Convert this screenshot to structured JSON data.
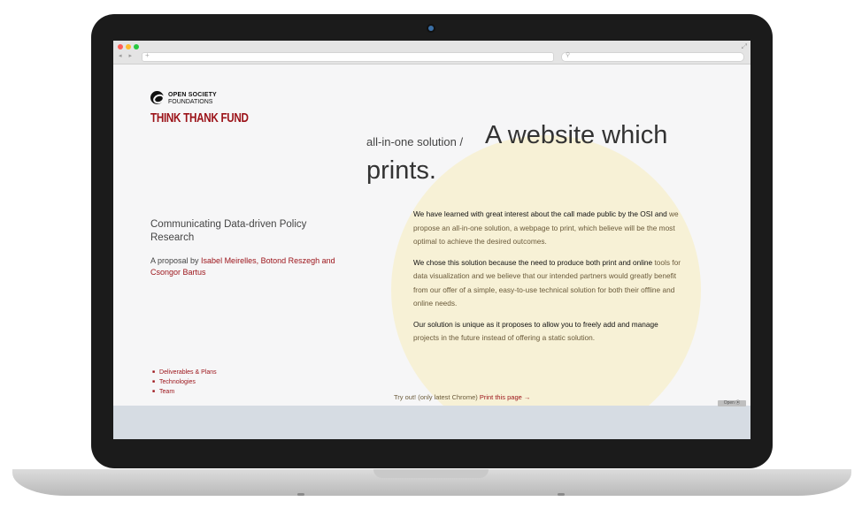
{
  "browser": {
    "traffic_colors": [
      "#ff5f57",
      "#febc2e",
      "#28c840"
    ],
    "nav": "◂ ▸",
    "url_plus": "+",
    "search_icon": "⚲",
    "resize_icon": "⤢"
  },
  "logo": {
    "org_line1": "OPEN SOCIETY",
    "org_line2": "FOUNDATIONS",
    "fund": "THINK THANK FUND"
  },
  "hero": {
    "prefix": "all-in-one solution /",
    "title_part1": "A website which",
    "title_part2": "prints."
  },
  "subtitle": "Communicating Data-driven Policy Research",
  "proposal": {
    "prefix": "A proposal by ",
    "authors": "Isabel Meirelles, Botond Reszegh and Csongor Bartus"
  },
  "paragraphs": [
    {
      "lead": "We have learned with great interest about the call made public by the OSI and",
      "rest": "we propose an all-in-one solution, a webpage to print, which believe will be the most optimal to achieve the desired outcomes."
    },
    {
      "lead": "We chose this solution because the need to produce both print and online",
      "rest": "tools for data visualization and we believe that our intended partners would greatly benefit from our offer of a simple, easy-to-use technical solution for both their offline and online needs."
    },
    {
      "lead": "Our solution is unique as it proposes to allow you to freely add and manage",
      "rest": "projects in the future instead of offering a static solution."
    }
  ],
  "nav": [
    "Deliverables & Plans",
    "Technologies",
    "Team"
  ],
  "tryout": {
    "prefix": "Try out! (only latest Chrome)",
    "link": "Print this page →"
  },
  "corner_badge": "Open ⦿",
  "colors": {
    "accent": "#9b1218",
    "circle": "#f7f1d6",
    "lower_band": "#d6dce3"
  }
}
